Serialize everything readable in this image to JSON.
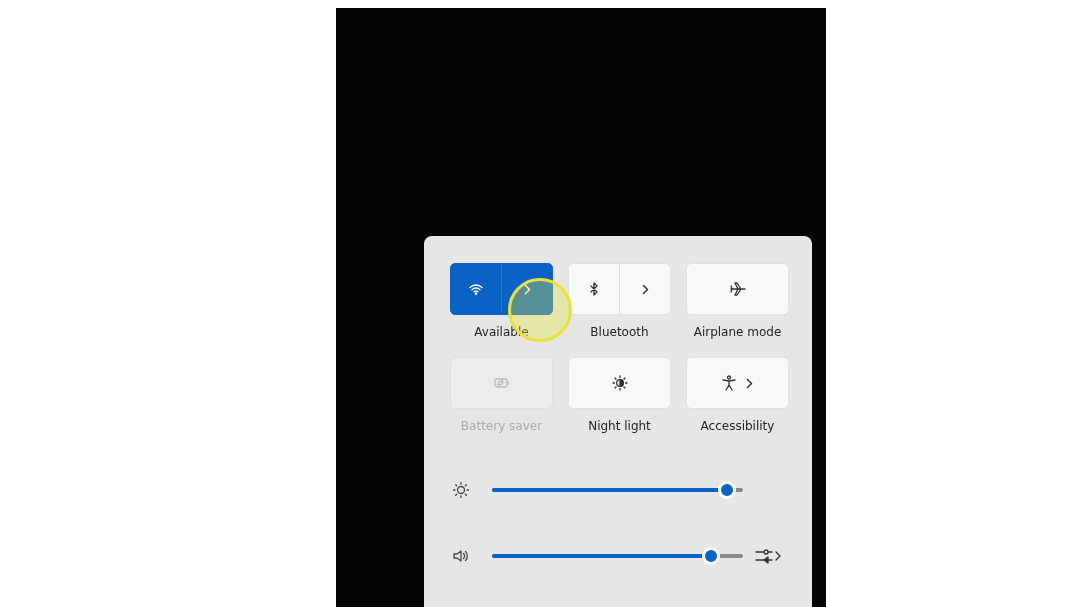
{
  "tiles": [
    {
      "kind": "split",
      "label": "Available",
      "on": true,
      "disabled": false
    },
    {
      "kind": "split",
      "label": "Bluetooth",
      "on": false,
      "disabled": false
    },
    {
      "kind": "plain",
      "label": "Airplane mode",
      "on": false,
      "disabled": false
    },
    {
      "kind": "plain",
      "label": "Battery saver",
      "on": false,
      "disabled": true
    },
    {
      "kind": "plain",
      "label": "Night light",
      "on": false,
      "disabled": false
    },
    {
      "kind": "chevron",
      "label": "Accessibility",
      "on": false,
      "disabled": false
    }
  ],
  "sliders": [
    {
      "kind": "brightness",
      "level": 0.97
    },
    {
      "kind": "volume",
      "level": 0.9
    }
  ]
}
